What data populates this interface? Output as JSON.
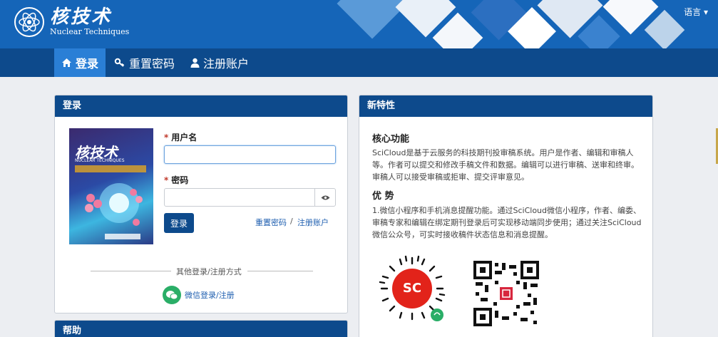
{
  "header": {
    "logo_cn": "核技术",
    "logo_en": "Nuclear Techniques",
    "language": "语言 ▾"
  },
  "nav": [
    {
      "label": "登录",
      "icon": "home-icon"
    },
    {
      "label": "重置密码",
      "icon": "key-icon"
    },
    {
      "label": "注册账户",
      "icon": "user-icon"
    }
  ],
  "login": {
    "panel_title": "登录",
    "username_label": "用户名",
    "username_value": "",
    "password_label": "密码",
    "password_value": "",
    "submit": "登录",
    "reset_link": "重置密码",
    "separator": "/",
    "register_link": "注册账户",
    "other_methods": "其他登录/注册方式",
    "wechat": "微信登录/注册",
    "cover": {
      "journal": "核技术",
      "subtitle": "NUCLEAR TECHNIQUES"
    }
  },
  "help": {
    "panel_title": "帮助"
  },
  "features": {
    "panel_title": "新特性",
    "core_title": "核心功能",
    "core_text": "SciCloud是基于云服务的科技期刊投审稿系统。用户是作者、编辑和审稿人等。作者可以提交和修改手稿文件和数据。编辑可以进行审稿、送审和终审。审稿人可以接受审稿或拒审、提交评审意见。",
    "adv_title": "优 势",
    "adv_text": "1.微信小程序和手机消息提醒功能。通过SciCloud微信小程序，作者、编委、审稿专家和编辑在绑定期刊登录后可实现移动端同步使用；通过关注SciCloud微信公众号，可实时接收稿件状态信息和消息提醒。",
    "miniprogram_mark": "SC"
  },
  "colors": {
    "header": "#1565b8",
    "nav": "#0d4a8c",
    "nav_active": "#2a7fd6",
    "panel_head": "#0d4a8c",
    "wechat_green": "#2aae67",
    "required": "#c0392b"
  }
}
